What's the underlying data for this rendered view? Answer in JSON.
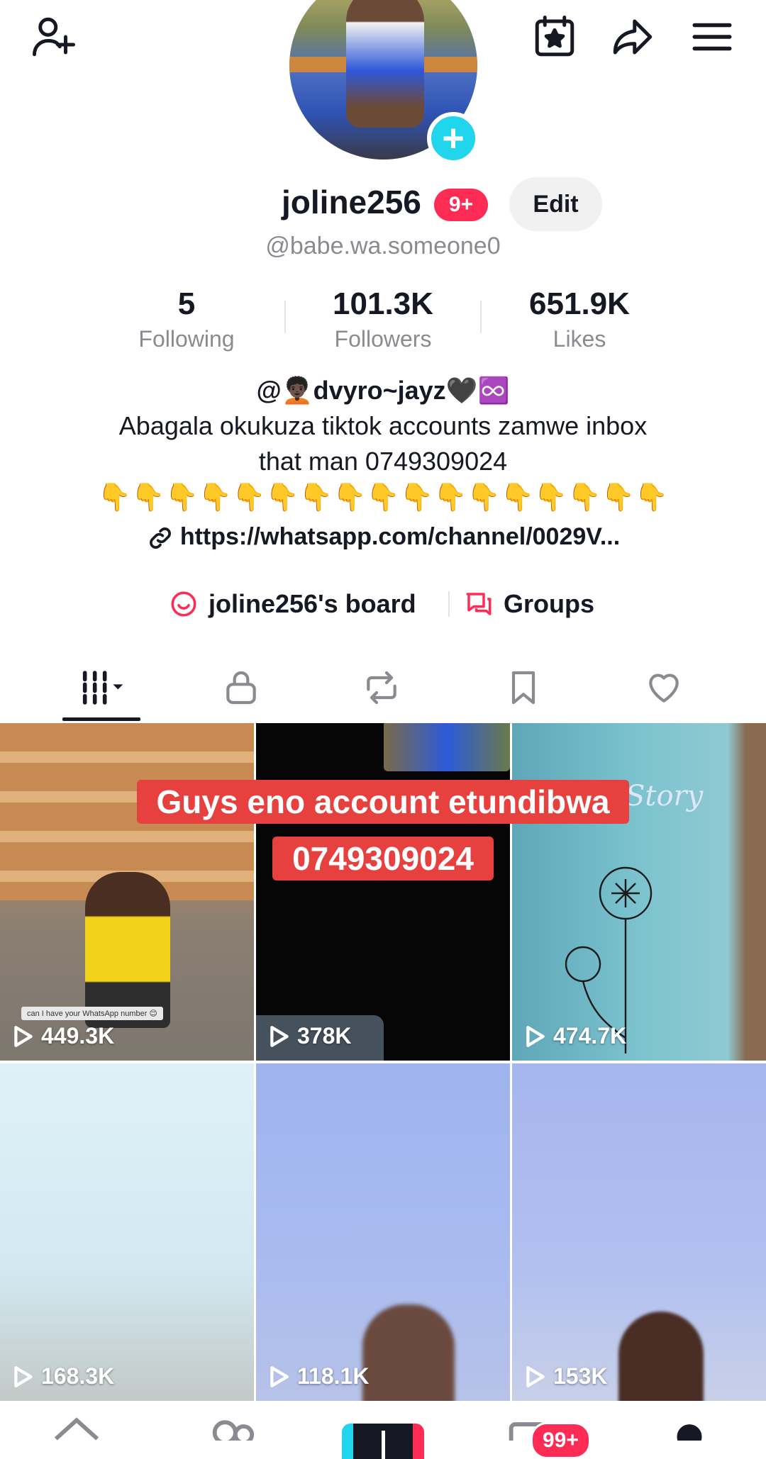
{
  "header": {
    "add_friend_icon": "person-plus-icon",
    "calendar_icon": "calendar-star-icon",
    "share_icon": "share-arrow-icon",
    "menu_icon": "hamburger-menu-icon"
  },
  "profile": {
    "username": "joline256",
    "notification_badge": "9+",
    "edit_label": "Edit",
    "handle": "@babe.wa.someone0",
    "stats": [
      {
        "value": "5",
        "label": "Following"
      },
      {
        "value": "101.3K",
        "label": "Followers"
      },
      {
        "value": "651.9K",
        "label": "Likes"
      }
    ],
    "bio": {
      "mention": "@🧑🏿‍🦱dvyro~jayz🖤♾️",
      "line1": "Abagala okukuza tiktok accounts zamwe inbox",
      "line2": "that man 0749309024",
      "emoji_line": "👇👇👇👇👇👇👇👇👇👇👇👇👇👇👇👇👇",
      "link": "https://whatsapp.com/channel/0029V..."
    },
    "boards": {
      "board_label": "joline256's board",
      "groups_label": "Groups"
    }
  },
  "tabs": [
    "videos-grid-icon",
    "lock-icon",
    "repost-icon",
    "bookmark-icon",
    "heart-icon"
  ],
  "videos": [
    {
      "views": "449.3K",
      "caption": "can I have your WhatsApp number 😊"
    },
    {
      "views": "378K"
    },
    {
      "views": "474.7K",
      "caption": "Story"
    },
    {
      "views": "168.3K"
    },
    {
      "views": "118.1K"
    },
    {
      "views": "153K"
    }
  ],
  "overlay": {
    "line1": "Guys eno account etundibwa",
    "line2": "0749309024"
  },
  "bottom_nav": {
    "inbox_badge": "99+"
  },
  "colors": {
    "accent": "#fe2c55",
    "cyan": "#20d5ec",
    "overlay_red": "#e6403f"
  }
}
